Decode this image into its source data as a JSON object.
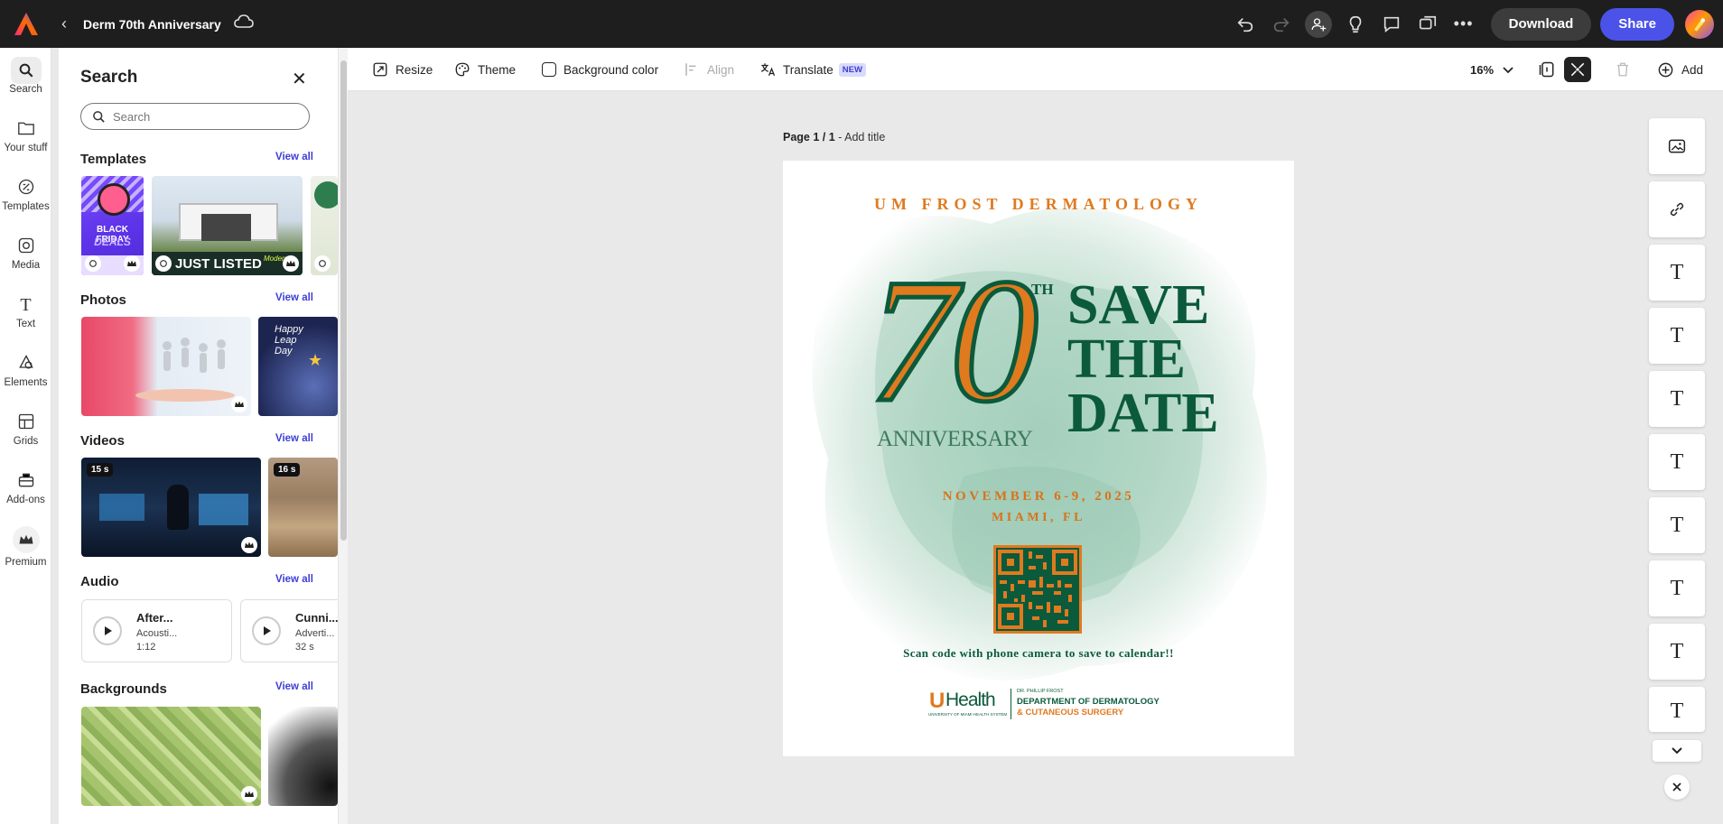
{
  "topbar": {
    "title": "Derm 70th Anniversary",
    "download_label": "Download",
    "share_label": "Share"
  },
  "rail": {
    "items": [
      {
        "label": "Search",
        "icon": "search-icon"
      },
      {
        "label": "Your stuff",
        "icon": "folder-icon"
      },
      {
        "label": "Templates",
        "icon": "templates-icon"
      },
      {
        "label": "Media",
        "icon": "media-icon"
      },
      {
        "label": "Text",
        "icon": "text-icon"
      },
      {
        "label": "Elements",
        "icon": "elements-icon"
      },
      {
        "label": "Grids",
        "icon": "grids-icon"
      },
      {
        "label": "Add-ons",
        "icon": "addons-icon"
      },
      {
        "label": "Premium",
        "icon": "premium-crown-icon"
      }
    ]
  },
  "panel": {
    "title": "Search",
    "search_placeholder": "Search",
    "view_all": "View all",
    "sections": {
      "templates": "Templates",
      "photos": "Photos",
      "videos": "Videos",
      "audio": "Audio",
      "backgrounds": "Backgrounds"
    },
    "template_texts": {
      "black_friday_1": "BLACK FRIDAY",
      "black_friday_2": "DEALS",
      "just_listed": "JUST LISTED",
      "just_listed_tag": "Modern"
    },
    "photo_texts": {
      "leap_day_1": "Happy",
      "leap_day_2": "Leap",
      "leap_day_3": "Day"
    },
    "videos": [
      {
        "duration": "15 s"
      },
      {
        "duration": "16 s"
      }
    ],
    "audio": [
      {
        "title": "After...",
        "subtitle": "Acousti...",
        "duration": "1:12"
      },
      {
        "title": "Cunni...",
        "subtitle": "Adverti...",
        "duration": "32 s"
      }
    ]
  },
  "toolbar": {
    "resize": "Resize",
    "theme": "Theme",
    "background_color": "Background color",
    "align": "Align",
    "translate": "Translate",
    "translate_badge": "NEW",
    "zoom": "16%",
    "add": "Add"
  },
  "canvas": {
    "page_label": "Page 1 / 1",
    "add_title": " - Add title"
  },
  "poster": {
    "header": "UM FROST DERMATOLOGY",
    "number": "70",
    "superscript": "TH",
    "anniversary": "ANNIVERSARY",
    "save_lines": [
      "SAVE",
      "THE",
      "DATE"
    ],
    "dates": "NOVEMBER 6-9, 2025",
    "location": "MIAMI, FL",
    "scan_text": "Scan code with phone camera to save to calendar!!",
    "logo_u": "U",
    "logo_health": "Health",
    "logo_system": "UNIVERSITY OF MIAMI HEALTH SYSTEM",
    "logo_dr": "DR. PHILLIP FROST",
    "logo_dept": "DEPARTMENT OF DERMATOLOGY",
    "logo_surgery": "& CUTANEOUS SURGERY",
    "colors": {
      "green": "#0b5a3b",
      "orange": "#e07a1f",
      "wash": "#cfe6db"
    }
  },
  "right_column": {
    "text_glyph": "T"
  }
}
